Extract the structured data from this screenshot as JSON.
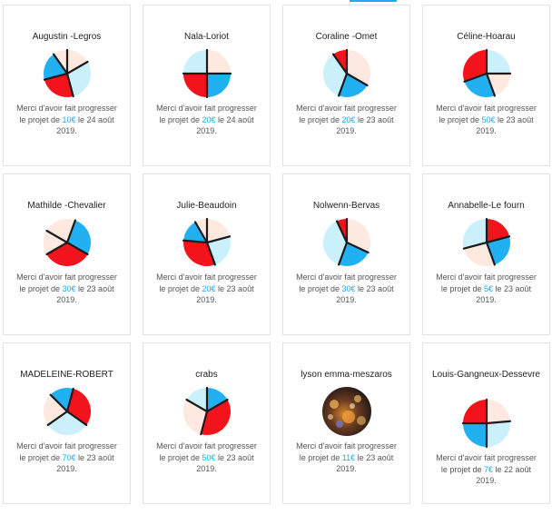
{
  "colors": {
    "red": "#f3131c",
    "blue": "#21b1f3",
    "light_blue": "#c9f0fb",
    "peach": "#fde9e0",
    "stroke": "#1b1b1b",
    "accent": "#1eaaf1"
  },
  "text": {
    "line1": "Merci d'avoir fait progresser",
    "prefix": "le projet de",
    "le": "le"
  },
  "cards": [
    {
      "name": "Augustin -Legros",
      "amount": "10€",
      "date": "24 août",
      "year": "2019.",
      "avatar": "pie-avatar",
      "wedges": [
        {
          "f": 0,
          "t": 60,
          "c": "peach"
        },
        {
          "f": 60,
          "t": 165,
          "c": "light_blue"
        },
        {
          "f": 165,
          "t": 255,
          "c": "red"
        },
        {
          "f": 255,
          "t": 325,
          "c": "blue"
        },
        {
          "f": 325,
          "t": 360,
          "c": "peach"
        }
      ]
    },
    {
      "name": "Nala-Loriot",
      "amount": "20€",
      "date": "24 août",
      "year": "2019.",
      "avatar": "pie-avatar",
      "wedges": [
        {
          "f": 0,
          "t": 90,
          "c": "peach"
        },
        {
          "f": 90,
          "t": 180,
          "c": "blue"
        },
        {
          "f": 180,
          "t": 270,
          "c": "red"
        },
        {
          "f": 270,
          "t": 360,
          "c": "light_blue"
        }
      ]
    },
    {
      "name": "Coraline -Omet",
      "amount": "20€",
      "date": "23 août",
      "year": "2019.",
      "avatar": "pie-avatar",
      "wedges": [
        {
          "f": 0,
          "t": 120,
          "c": "peach"
        },
        {
          "f": 120,
          "t": 200,
          "c": "blue"
        },
        {
          "f": 200,
          "t": 325,
          "c": "light_blue"
        },
        {
          "f": 325,
          "t": 360,
          "c": "red"
        }
      ]
    },
    {
      "name": "Céline-Hoarau",
      "amount": "50€",
      "date": "23 août",
      "year": "2019.",
      "avatar": "pie-avatar",
      "wedges": [
        {
          "f": 0,
          "t": 90,
          "c": "light_blue"
        },
        {
          "f": 90,
          "t": 160,
          "c": "peach"
        },
        {
          "f": 160,
          "t": 250,
          "c": "blue"
        },
        {
          "f": 250,
          "t": 360,
          "c": "red"
        }
      ]
    },
    {
      "name": "Mathilde -Chevalier",
      "amount": "30€",
      "date": "23 août",
      "year": "2019.",
      "avatar": "pie-avatar",
      "wedges": [
        {
          "f": 20,
          "t": 120,
          "c": "blue"
        },
        {
          "f": 120,
          "t": 240,
          "c": "red"
        },
        {
          "f": 240,
          "t": 300,
          "c": "peach"
        },
        {
          "f": 300,
          "t": 380,
          "c": "peach"
        }
      ]
    },
    {
      "name": "Julie-Beaudoin",
      "amount": "20€",
      "date": "23 août",
      "year": "2019.",
      "avatar": "pie-avatar",
      "wedges": [
        {
          "f": 0,
          "t": 75,
          "c": "peach"
        },
        {
          "f": 75,
          "t": 160,
          "c": "light_blue"
        },
        {
          "f": 160,
          "t": 275,
          "c": "red"
        },
        {
          "f": 275,
          "t": 330,
          "c": "blue"
        },
        {
          "f": 330,
          "t": 360,
          "c": "peach"
        }
      ]
    },
    {
      "name": "Nolwenn-Bervas",
      "amount": "30€",
      "date": "23 août",
      "year": "2019.",
      "avatar": "pie-avatar",
      "wedges": [
        {
          "f": 0,
          "t": 115,
          "c": "peach"
        },
        {
          "f": 115,
          "t": 200,
          "c": "blue"
        },
        {
          "f": 200,
          "t": 335,
          "c": "light_blue"
        },
        {
          "f": 335,
          "t": 360,
          "c": "red"
        }
      ]
    },
    {
      "name": "Annabelle-Le fourn",
      "amount": "5€",
      "date": "23 août",
      "year": "2019.",
      "avatar": "pie-avatar",
      "wedges": [
        {
          "f": 0,
          "t": 75,
          "c": "red"
        },
        {
          "f": 75,
          "t": 160,
          "c": "blue"
        },
        {
          "f": 160,
          "t": 255,
          "c": "peach"
        },
        {
          "f": 255,
          "t": 360,
          "c": "light_blue"
        }
      ]
    },
    {
      "name": "MADELEINE-ROBERT",
      "amount": "70€",
      "date": "23 août",
      "year": "2019.",
      "avatar": "pie-avatar",
      "wedges": [
        {
          "f": 15,
          "t": 125,
          "c": "red"
        },
        {
          "f": 125,
          "t": 235,
          "c": "light_blue"
        },
        {
          "f": 235,
          "t": 315,
          "c": "peach"
        },
        {
          "f": 315,
          "t": 375,
          "c": "blue"
        }
      ]
    },
    {
      "name": "crabs",
      "amount": "50€",
      "date": "23 août",
      "year": "2019.",
      "avatar": "pie-avatar",
      "wedges": [
        {
          "f": 0,
          "t": 60,
          "c": "blue"
        },
        {
          "f": 60,
          "t": 195,
          "c": "red"
        },
        {
          "f": 195,
          "t": 300,
          "c": "peach"
        },
        {
          "f": 300,
          "t": 360,
          "c": "light_blue"
        }
      ]
    },
    {
      "name": "lyson emma-meszaros",
      "amount": "11€",
      "date": "23 août",
      "year": "2019.",
      "avatar": "photo-avatar",
      "wedges": []
    },
    {
      "name": "Louis-Gangneux-Dessevre",
      "amount": "7€",
      "date": "22 août",
      "year": "2019.",
      "avatar": "pie-avatar",
      "wedges": [
        {
          "f": 0,
          "t": 85,
          "c": "peach"
        },
        {
          "f": 85,
          "t": 180,
          "c": "light_blue"
        },
        {
          "f": 180,
          "t": 270,
          "c": "blue"
        },
        {
          "f": 270,
          "t": 360,
          "c": "red"
        }
      ]
    }
  ]
}
